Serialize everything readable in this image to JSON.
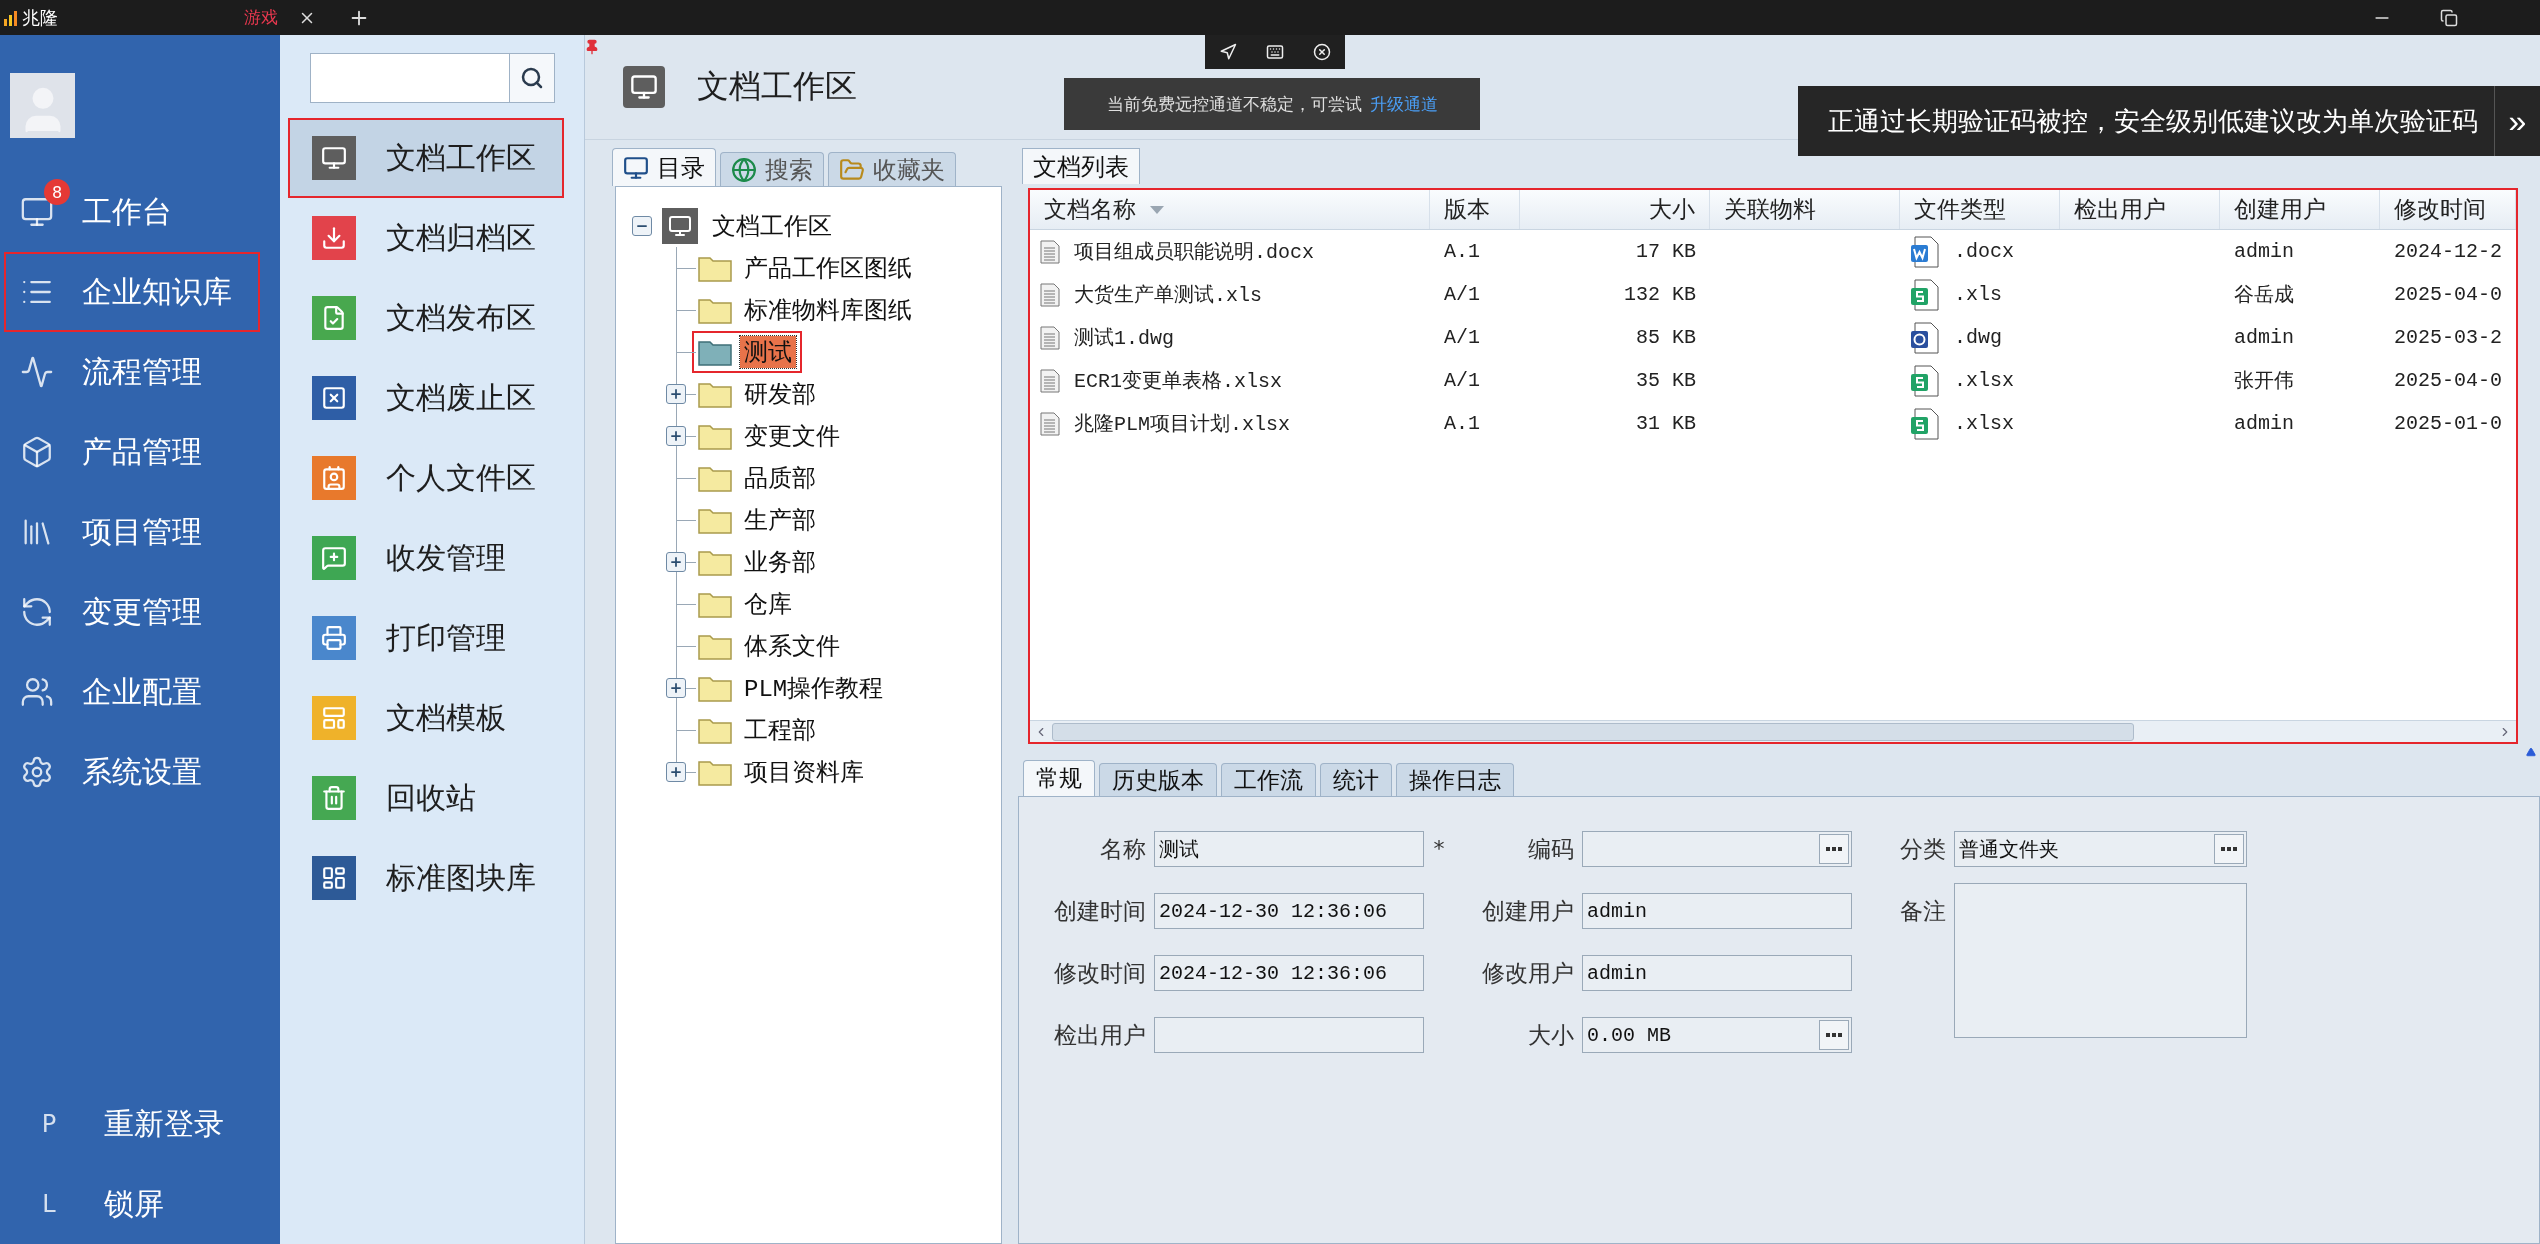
{
  "browser": {
    "tab": {
      "title": "兆隆",
      "tag": "游戏"
    }
  },
  "remote_notice": {
    "text": "当前免费远控通道不稳定，可尝试",
    "link": "升级通道"
  },
  "security_notice": {
    "text": "正通过长期验证码被控，安全级别低建议改为单次验证码",
    "button": "»"
  },
  "sidebar": {
    "items": [
      {
        "label": "工作台",
        "badge": "8",
        "highlighted": false
      },
      {
        "label": "企业知识库",
        "highlighted": true
      },
      {
        "label": "流程管理",
        "highlighted": false
      },
      {
        "label": "产品管理",
        "highlighted": false
      },
      {
        "label": "项目管理",
        "highlighted": false
      },
      {
        "label": "变更管理",
        "highlighted": false
      },
      {
        "label": "企业配置",
        "highlighted": false
      },
      {
        "label": "系统设置",
        "highlighted": false
      }
    ],
    "footer": [
      {
        "key": "P",
        "label": "重新登录"
      },
      {
        "key": "L",
        "label": "锁屏"
      }
    ]
  },
  "subnav": {
    "items": [
      {
        "label": "文档工作区",
        "color": "#5e5e5e",
        "selected": true,
        "highlighted": true
      },
      {
        "label": "文档归档区",
        "color": "#e2434b",
        "selected": false,
        "highlighted": false
      },
      {
        "label": "文档发布区",
        "color": "#48a84e",
        "selected": false,
        "highlighted": false
      },
      {
        "label": "文档废止区",
        "color": "#2e5ea6",
        "selected": false,
        "highlighted": false
      },
      {
        "label": "个人文件区",
        "color": "#e8792c",
        "selected": false,
        "highlighted": false
      },
      {
        "label": "收发管理",
        "color": "#3ea753",
        "selected": false,
        "highlighted": false
      },
      {
        "label": "打印管理",
        "color": "#4a87cc",
        "selected": false,
        "highlighted": false
      },
      {
        "label": "文档模板",
        "color": "#efb22a",
        "selected": false,
        "highlighted": false
      },
      {
        "label": "回收站",
        "color": "#45a852",
        "selected": false,
        "highlighted": false
      },
      {
        "label": "标准图块库",
        "color": "#2d5a97",
        "selected": false,
        "highlighted": false
      }
    ]
  },
  "header": {
    "title": "文档工作区"
  },
  "left_tabs": [
    {
      "label": "目录",
      "selected": true
    },
    {
      "label": "搜索",
      "selected": false
    },
    {
      "label": "收藏夹",
      "selected": false
    }
  ],
  "tree": {
    "label": "文档工作区",
    "expanded": true,
    "children": [
      {
        "label": "产品工作区图纸",
        "expandable": false,
        "selected": false,
        "highlighted": false
      },
      {
        "label": "标准物料库图纸",
        "expandable": false,
        "selected": false,
        "highlighted": false
      },
      {
        "label": "测试",
        "expandable": false,
        "selected": true,
        "highlighted": true
      },
      {
        "label": "研发部",
        "expandable": true,
        "selected": false,
        "highlighted": false
      },
      {
        "label": "变更文件",
        "expandable": true,
        "selected": false,
        "highlighted": false
      },
      {
        "label": "品质部",
        "expandable": false,
        "selected": false,
        "highlighted": false
      },
      {
        "label": "生产部",
        "expandable": false,
        "selected": false,
        "highlighted": false
      },
      {
        "label": "业务部",
        "expandable": true,
        "selected": false,
        "highlighted": false
      },
      {
        "label": "仓库",
        "expandable": false,
        "selected": false,
        "highlighted": false
      },
      {
        "label": "体系文件",
        "expandable": false,
        "selected": false,
        "highlighted": false
      },
      {
        "label": "PLM操作教程",
        "expandable": true,
        "selected": false,
        "highlighted": false
      },
      {
        "label": "工程部",
        "expandable": false,
        "selected": false,
        "highlighted": false
      },
      {
        "label": "项目资料库",
        "expandable": true,
        "selected": false,
        "highlighted": false
      }
    ]
  },
  "list_tab": {
    "label": "文档列表"
  },
  "table": {
    "highlighted": true,
    "columns": [
      "文档名称",
      "版本",
      "大小",
      "关联物料",
      "文件类型",
      "检出用户",
      "创建用户",
      "修改时间"
    ],
    "rows": [
      {
        "name": "项目组成员职能说明.docx",
        "version": "A.1",
        "size": "17 KB",
        "kind": "word",
        "type": ".docx",
        "creator": "admin",
        "modified": "2024-12-2"
      },
      {
        "name": "大货生产单测试.xls",
        "version": "A/1",
        "size": "132 KB",
        "kind": "sheet",
        "type": ".xls",
        "creator": "谷岳成",
        "modified": "2025-04-0"
      },
      {
        "name": "测试1.dwg",
        "version": "A/1",
        "size": "85 KB",
        "kind": "cad",
        "type": ".dwg",
        "creator": "admin",
        "modified": "2025-03-2"
      },
      {
        "name": "ECR1变更单表格.xlsx",
        "version": "A/1",
        "size": "35 KB",
        "kind": "sheet",
        "type": ".xlsx",
        "creator": "张开伟",
        "modified": "2025-04-0"
      },
      {
        "name": "兆隆PLM项目计划.xlsx",
        "version": "A.1",
        "size": "31 KB",
        "kind": "sheet",
        "type": ".xlsx",
        "creator": "admin",
        "modified": "2025-01-0"
      }
    ]
  },
  "detail_tabs": [
    {
      "label": "常规",
      "selected": true
    },
    {
      "label": "历史版本",
      "selected": false
    },
    {
      "label": "工作流",
      "selected": false
    },
    {
      "label": "统计",
      "selected": false
    },
    {
      "label": "操作日志",
      "selected": false
    }
  ],
  "form": {
    "columns": [
      [
        {
          "label": "名称",
          "kind": "text",
          "value": "测试",
          "mark": "*"
        },
        {
          "label": "创建时间",
          "kind": "text",
          "value": "2024-12-30 12:36:06"
        },
        {
          "label": "修改时间",
          "kind": "text",
          "value": "2024-12-30 12:36:06"
        },
        {
          "label": "检出用户",
          "kind": "text"
        }
      ],
      [
        {
          "label": "编码",
          "kind": "picker"
        },
        {
          "label": "创建用户",
          "kind": "text",
          "value": "admin"
        },
        {
          "label": "修改用户",
          "kind": "text",
          "value": "admin"
        },
        {
          "label": "大小",
          "kind": "picker",
          "value": "0.00 MB"
        }
      ],
      [
        {
          "label": "分类",
          "kind": "picker",
          "value": "普通文件夹"
        },
        {
          "label": "备注",
          "kind": "memo"
        }
      ]
    ]
  }
}
